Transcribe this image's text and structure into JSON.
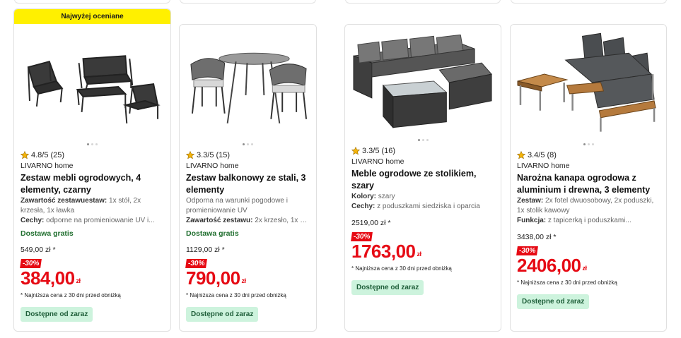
{
  "products": [
    {
      "badge_top": "Najwyżej oceniane",
      "rating": "4.8/5 (25)",
      "brand": "LIVARNO home",
      "title": "Zestaw mebli ogrodowych, 4 elementy, czarny",
      "specs": [
        {
          "label": "Zawartość zestawuestaw:",
          "value": " 1x stół, 2x krzesła, 1x ławka"
        },
        {
          "label": "Cechy:",
          "value": " odporne na promieniowanie UV i..."
        }
      ],
      "shipping": "Dostawa gratis",
      "old_price": "549,00 zł *",
      "discount": "-30%",
      "price": "384,00",
      "currency": "zł",
      "lowest_note": "* Najniższa cena z 30 dni przed obniżką",
      "availability": "Dostępne od zaraz"
    },
    {
      "rating": "3.3/5 (15)",
      "brand": "LIVARNO home",
      "title": "Zestaw balkonowy ze stali, 3 elementy",
      "description": "Odporna na warunki pogodowe i promieniowanie UV",
      "specs": [
        {
          "label": "Zawartość zestawu:",
          "value": " 2x krzesło, 1x stół..."
        }
      ],
      "shipping": "Dostawa gratis",
      "old_price": "1129,00 zł *",
      "discount": "-30%",
      "price": "790,00",
      "currency": "zł",
      "lowest_note": "* Najniższa cena z 30 dni przed obniżką",
      "availability": "Dostępne od zaraz"
    },
    {
      "rating": "3.3/5 (16)",
      "brand": "LIVARNO home",
      "title": "Meble ogrodowe ze stolikiem, szary",
      "specs": [
        {
          "label": "Kolory:",
          "value": " szary"
        },
        {
          "label": "Cechy:",
          "value": " z poduszkami siedziska i oparcia"
        }
      ],
      "old_price": "2519,00 zł *",
      "discount": "-30%",
      "price": "1763,00",
      "currency": "zł",
      "lowest_note": "* Najniższa cena z 30 dni przed obniżką",
      "availability": "Dostępne od zaraz"
    },
    {
      "rating": "3.4/5 (8)",
      "brand": "LIVARNO home",
      "title": "Narożna kanapa ogrodowa z aluminium i drewna, 3 elementy",
      "specs": [
        {
          "label": "Zestaw:",
          "value": " 2x fotel dwuosobowy, 2x poduszki, 1x stolik kawowy"
        },
        {
          "label": "Funkcja:",
          "value": " z tapicerką i poduszkami..."
        }
      ],
      "old_price": "3438,00 zł *",
      "discount": "-30%",
      "price": "2406,00",
      "currency": "zł",
      "lowest_note": "* Najniższa cena z 30 dni przed obniżką",
      "availability": "Dostępne od zaraz"
    }
  ]
}
